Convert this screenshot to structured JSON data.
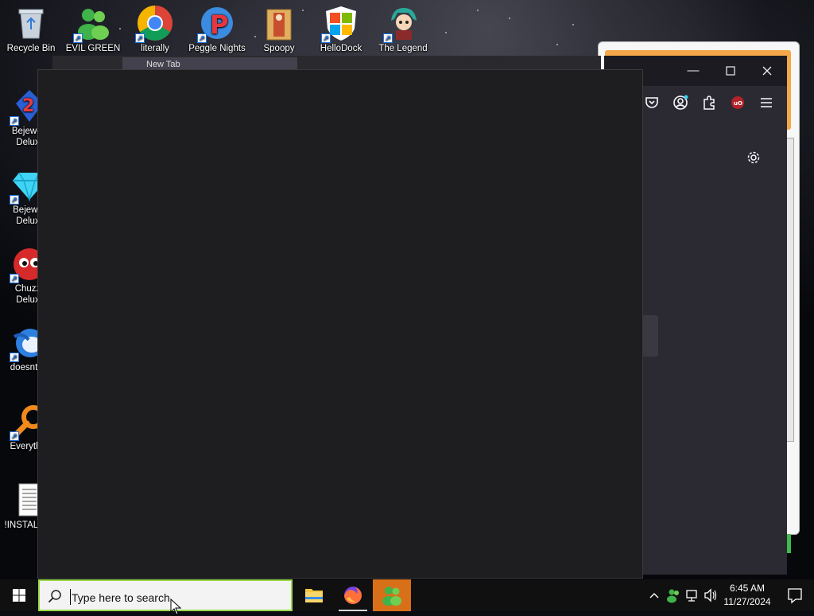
{
  "desktop": {
    "icons_top": [
      {
        "label": "Recycle Bin",
        "icon": "recycle-bin-icon"
      },
      {
        "label": "EVIL GREEN",
        "icon": "green-people-icon"
      },
      {
        "label": "literally",
        "icon": "chrome-icon"
      },
      {
        "label": "Peggle Nights",
        "icon": "peggle-icon"
      },
      {
        "label": "Spoopy",
        "icon": "folder-figure-icon"
      },
      {
        "label": "HelloDock",
        "icon": "windows-shield-icon"
      },
      {
        "label": "The Legend",
        "icon": "anime-character-icon"
      }
    ],
    "icons_left": [
      {
        "label_line1": "Bejewel",
        "label_line2": "Delux",
        "icon": "bejeweled2-icon"
      },
      {
        "label_line1": "Bejewe",
        "label_line2": "Delux",
        "icon": "diamond-icon"
      },
      {
        "label_line1": "Chuzz",
        "label_line2": "Delux",
        "icon": "chuzzle-icon"
      },
      {
        "label_line1": "doesnt",
        "label_line2": "",
        "icon": "blue-bird-icon"
      },
      {
        "label_line1": "Everyth",
        "label_line2": "",
        "icon": "everything-search-icon"
      },
      {
        "label_line1": "!INSTALL",
        "label_line2": "",
        "icon": "text-document-icon"
      }
    ]
  },
  "firefox": {
    "tab_title": "New Tab"
  },
  "taskbar": {
    "search_placeholder": "Type here to search",
    "clock_time": "6:45 AM",
    "clock_date": "11/27/2024",
    "accent_color": "#d8701a"
  }
}
